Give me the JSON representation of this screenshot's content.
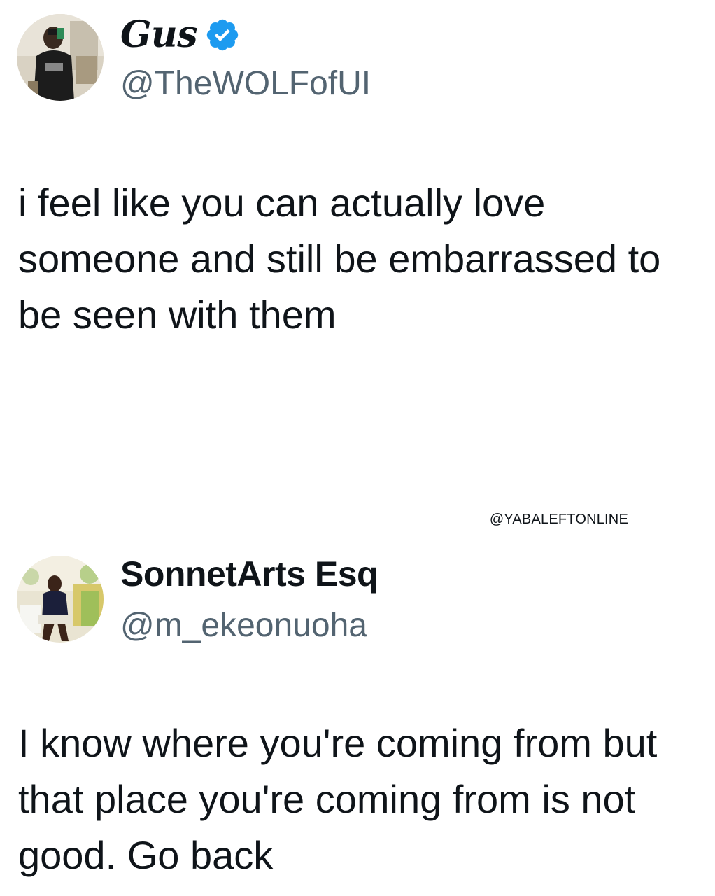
{
  "tweets": [
    {
      "display_name": "Gus",
      "verified": true,
      "handle": "@TheWOLFofUI",
      "text": "i feel like you can actually love someone and still be embarrassed to be seen with them"
    },
    {
      "display_name": "SonnetArts Esq",
      "verified": false,
      "handle": "@m_ekeonuoha",
      "text": "I know where you're coming from but that place you're coming from is not good. Go back"
    }
  ],
  "watermark": "@YABALEFTONLINE",
  "colors": {
    "text_primary": "#0f1419",
    "text_secondary": "#536471",
    "verified_blue": "#1d9bf0"
  }
}
